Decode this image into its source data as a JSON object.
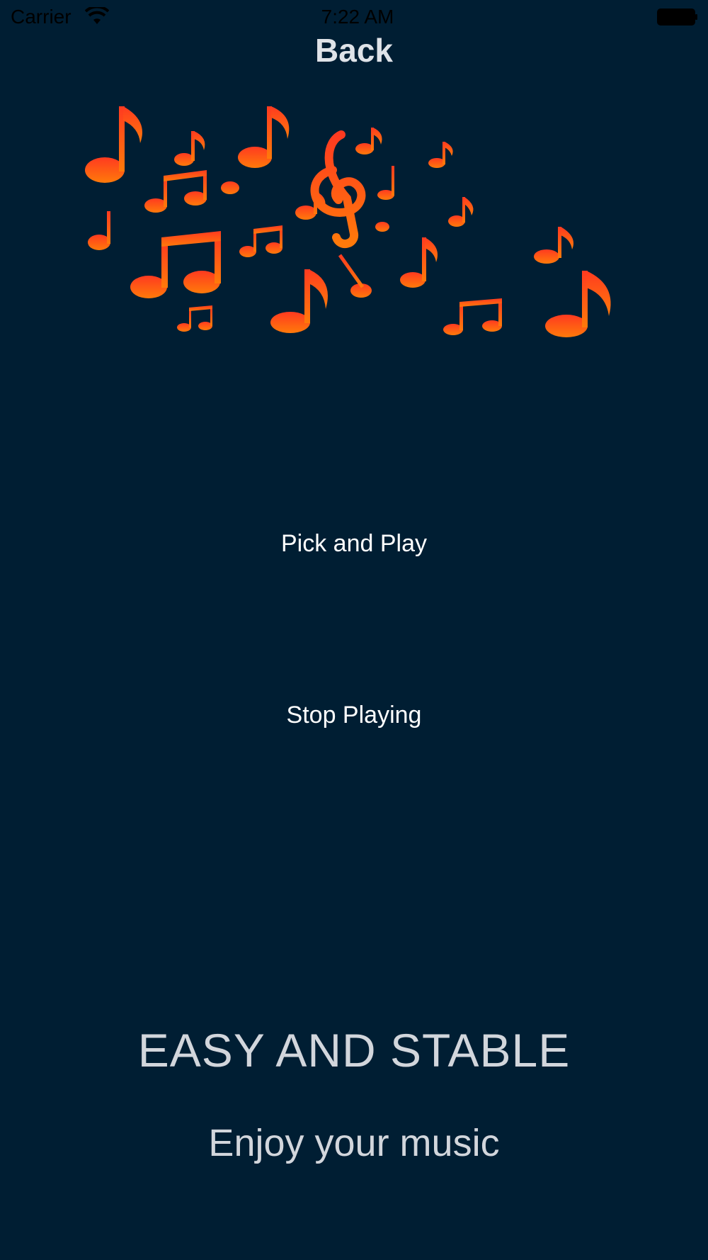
{
  "status_bar": {
    "carrier": "Carrier",
    "time": "7:22 AM",
    "wifi_icon": "wifi-icon",
    "battery_icon": "battery-icon"
  },
  "nav": {
    "back_label": "Back"
  },
  "hero": {
    "icon": "music-notes-illustration",
    "note_color_red": "#ff4a1c",
    "note_color_orange": "#ff7a10"
  },
  "actions": {
    "pick_label": "Pick and Play",
    "stop_label": "Stop Playing"
  },
  "promo": {
    "headline": "EASY AND STABLE",
    "subline": "Enjoy your music"
  },
  "theme": {
    "background": "#001e33",
    "text": "#d2d6dc"
  }
}
